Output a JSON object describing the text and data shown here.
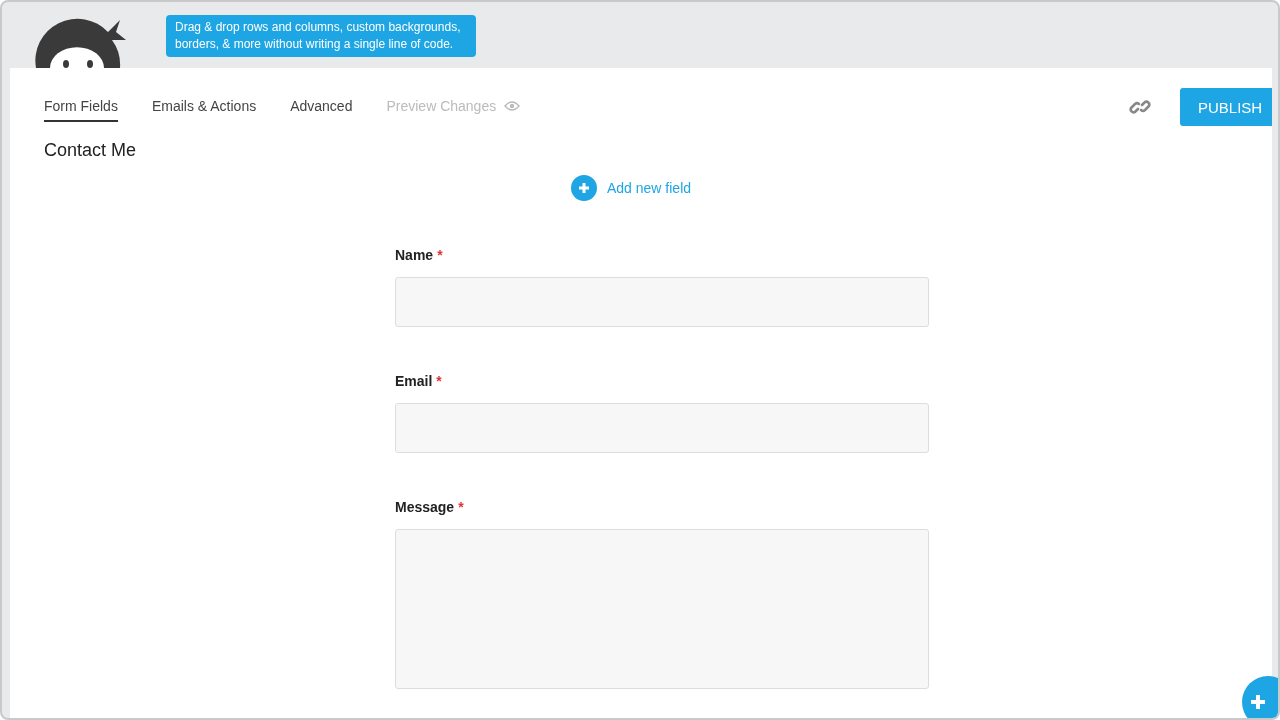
{
  "tooltip": "Drag & drop rows and columns, custom backgrounds, borders, & more without writing a single line of code.",
  "tabs": [
    {
      "label": "Form Fields",
      "selected": true,
      "disabled": false
    },
    {
      "label": "Emails & Actions",
      "selected": false,
      "disabled": false
    },
    {
      "label": "Advanced",
      "selected": false,
      "disabled": false
    },
    {
      "label": "Preview Changes",
      "selected": false,
      "disabled": true
    }
  ],
  "publish_button": "PUBLISH",
  "form_title": "Contact Me",
  "add_field": "Add new field",
  "fields": [
    {
      "label": "Name",
      "required": true,
      "kind": "input"
    },
    {
      "label": "Email",
      "required": true,
      "kind": "input"
    },
    {
      "label": "Message",
      "required": true,
      "kind": "textarea"
    }
  ],
  "required_mark": "*"
}
